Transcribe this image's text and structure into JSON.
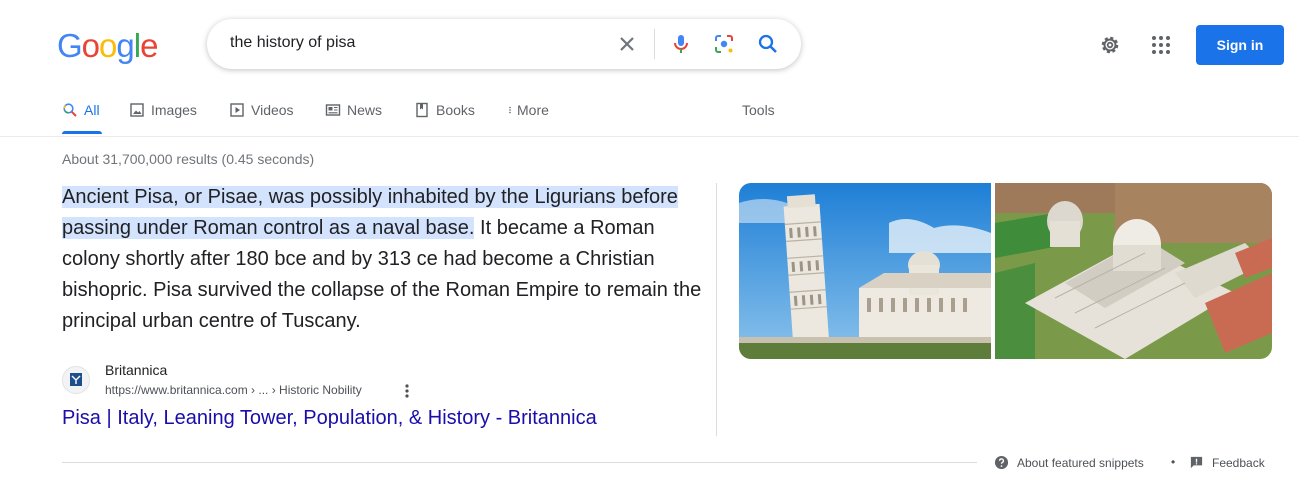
{
  "logo": {
    "letters": [
      "G",
      "o",
      "o",
      "g",
      "l",
      "e"
    ],
    "colors": [
      "#4285f4",
      "#ea4335",
      "#fbbc05",
      "#4285f4",
      "#34a853",
      "#ea4335"
    ]
  },
  "search": {
    "query": "the history of pisa"
  },
  "header": {
    "signin_label": "Sign in"
  },
  "tabs": [
    {
      "label": "All",
      "icon": "search-icon"
    },
    {
      "label": "Images",
      "icon": "image-icon"
    },
    {
      "label": "Videos",
      "icon": "video-icon"
    },
    {
      "label": "News",
      "icon": "news-icon"
    },
    {
      "label": "Books",
      "icon": "book-icon"
    },
    {
      "label": "More",
      "icon": "more-vert-icon"
    }
  ],
  "tools_label": "Tools",
  "stats": "About 31,700,000 results (0.45 seconds)",
  "snippet": {
    "highlight": "Ancient Pisa, or Pisae, was possibly inhabited by the Ligurians before passing under Roman control as a naval base.",
    "rest": " It became a Roman colony shortly after 180 bce and by 313 ce had become a Christian bishopric. Pisa survived the collapse of the Roman Empire to remain the principal urban centre of Tuscany."
  },
  "source": {
    "name": "Britannica",
    "url": "https://www.britannica.com › ... › Historic Nobility",
    "title": "Pisa | Italy, Leaning Tower, Population, & History - Britannica"
  },
  "footer": {
    "about": "About featured snippets",
    "separator": "•",
    "feedback": "Feedback"
  },
  "colors": {
    "accent": "#1a73e8",
    "link": "#1a0dab",
    "highlight": "#d3e3fd"
  }
}
